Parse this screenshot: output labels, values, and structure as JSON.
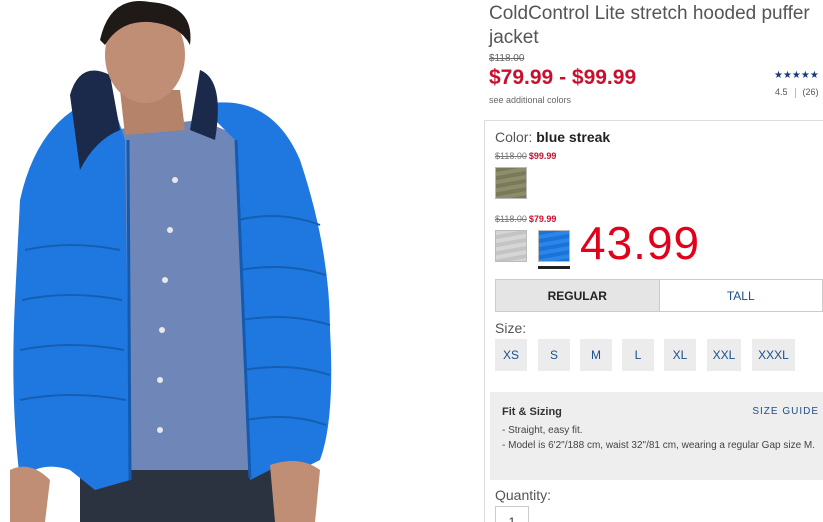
{
  "product": {
    "title": "ColdControl Lite stretch hooded puffer jacket",
    "original_price": "$118.00",
    "price_range": "$79.99 - $99.99",
    "see_colors": "see additional colors",
    "stars": "★★★★★",
    "rating_value": "4.5",
    "review_count": "(26)"
  },
  "color": {
    "label": "Color:",
    "selected": "blue streak"
  },
  "swatch_groups": [
    {
      "old_price": "$118.00",
      "new_price": "$99.99"
    },
    {
      "old_price": "$118.00",
      "new_price": "$79.99"
    }
  ],
  "swatch_colors": {
    "olive": "#7f7f5e",
    "grey": "#cfcfcf",
    "blue_streak": "#1f78e0"
  },
  "annotation_price": "43.99",
  "fit_tabs": [
    "REGULAR",
    "TALL"
  ],
  "size": {
    "label": "Size:",
    "options": [
      "XS",
      "S",
      "M",
      "L",
      "XL",
      "XXL",
      "XXXL"
    ]
  },
  "fit_sizing": {
    "heading": "Fit & Sizing",
    "guide_link": "SIZE GUIDE",
    "bullets": [
      "- Straight, easy fit.",
      "- Model is 6'2\"/188 cm, waist 32\"/81 cm, wearing a regular Gap size M."
    ]
  },
  "quantity": {
    "label": "Quantity:",
    "value": "1"
  },
  "accent_colors": {
    "sale_red": "#c8102e",
    "link_blue": "#1a4f8b"
  }
}
